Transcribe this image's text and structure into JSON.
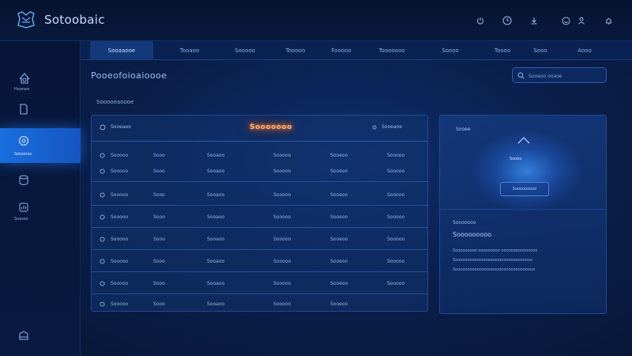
{
  "app": {
    "title": "Sotoobaic"
  },
  "colors": {
    "accent": "#1a6ee0",
    "highlight": "#ff8a3a",
    "background": "#0a1f4c"
  },
  "header_icons": [
    "power-icon",
    "clock-icon",
    "download-icon",
    "smile-icon",
    "user-icon",
    "bell-icon"
  ],
  "sidebar": {
    "items": [
      {
        "icon": "dashboard-icon",
        "label": "Hoonee"
      },
      {
        "icon": "document-icon",
        "label": ""
      },
      {
        "icon": "settings-icon",
        "label": "Sotoeras"
      },
      {
        "icon": "database-icon",
        "label": ""
      },
      {
        "icon": "chart-icon",
        "label": "Sooses"
      },
      {
        "icon": "help-icon",
        "label": ""
      }
    ]
  },
  "tabs": [
    "Sooaaooe",
    "Tooaoo",
    "Sooooo",
    "Tooooo",
    "Fooooo",
    "Tooooooo",
    "Soooo",
    "Toooo",
    "Sooo",
    "Aooo"
  ],
  "page_title": "Pooeofoioaioooe",
  "search": {
    "placeholder": "Sooaoo ooaoe"
  },
  "section_label": "Sooooeaoooe",
  "table": {
    "header_left": "Sooeaeo",
    "header_highlight": "Sooooooo",
    "header_right": "Sooeaoe",
    "rows": [
      {
        "cells": [
          "Sooooo",
          "Sooo",
          "Sooaoo",
          "Sooooo",
          "Sooeoo",
          "Sooooo"
        ]
      },
      {
        "cells": [
          "Sooooo",
          "Sooo",
          "Sooaoo",
          "Sooooo",
          "Sooeoo",
          "Sooooo"
        ]
      },
      {
        "cells": [
          "Sooooo",
          "Sooo",
          "Sooaoo",
          "Sooooo",
          "Sooeoo",
          "Sooooo"
        ]
      },
      {
        "cells": [
          "Sooooo",
          "Sooo",
          "Sooaoo",
          "Sooooo",
          "Sooeoo",
          "Sooooo"
        ]
      },
      {
        "cells": [
          "Sooooo",
          "Sooo",
          "Sooaoo",
          "Sooooo",
          "Sooeoo",
          "Sooooo"
        ]
      },
      {
        "cells": [
          "Sooooo",
          "Sooo",
          "Sooaoo",
          "Sooooo",
          "Sooeoo",
          "Sooooo"
        ]
      },
      {
        "cells": [
          "Sooooo",
          "Sooo",
          "Sooaoo",
          "Sooooo",
          "Sooeoo",
          "Sooooo"
        ]
      },
      {
        "cells": [
          "Sooooo",
          "Sooo",
          "Sooaoo",
          "Sooooo",
          "Sooeoo",
          ""
        ]
      }
    ]
  },
  "detail": {
    "title": "Sooee",
    "small_text": "Soooo",
    "button_label": "Sooooooooo",
    "label": "Sooooooo",
    "value": "Sooooooooo",
    "desc": [
      "Sooooooooo ooooooooo ooooooooooooooo",
      "Soooooooooooooooooooooooooooooooo",
      "Sooooooooooooooooooooooooooooooooo"
    ]
  }
}
